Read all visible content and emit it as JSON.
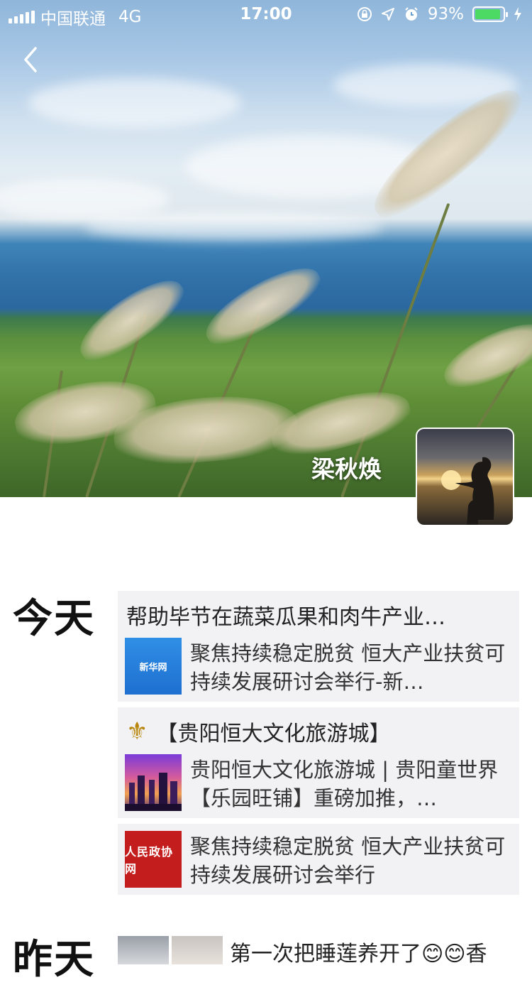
{
  "status_bar": {
    "carrier": "中国联通",
    "network": "4G",
    "time": "17:00",
    "battery_text": "93%",
    "battery_level": 0.93,
    "battery_color": "#4cd964"
  },
  "profile": {
    "name": "梁秋焕"
  },
  "feed": {
    "days": [
      {
        "label": "今天",
        "entries": [
          {
            "title": "帮助毕节在蔬菜瓜果和肉牛产业…",
            "thumb_icon": "xinhua-news-logo",
            "thumb_text": "新华网",
            "desc": "聚焦持续稳定脱贫 恒大产业扶贫可持续发展研讨会举行-新…"
          },
          {
            "title": "【贵阳恒大文化旅游城】",
            "title_icon": "fleur-de-lis-icon",
            "thumb_icon": "city-night-image",
            "desc": "贵阳恒大文化旅游城 | 贵阳童世界【乐园旺铺】重磅加推，…"
          },
          {
            "thumb_icon": "rmzx-logo",
            "thumb_text": "人民政协网",
            "desc": "聚焦持续稳定脱贫 恒大产业扶贫可持续发展研讨会举行"
          }
        ]
      },
      {
        "label": "昨天",
        "partial_text": "第一次把睡莲养开了😊😊香"
      }
    ]
  }
}
